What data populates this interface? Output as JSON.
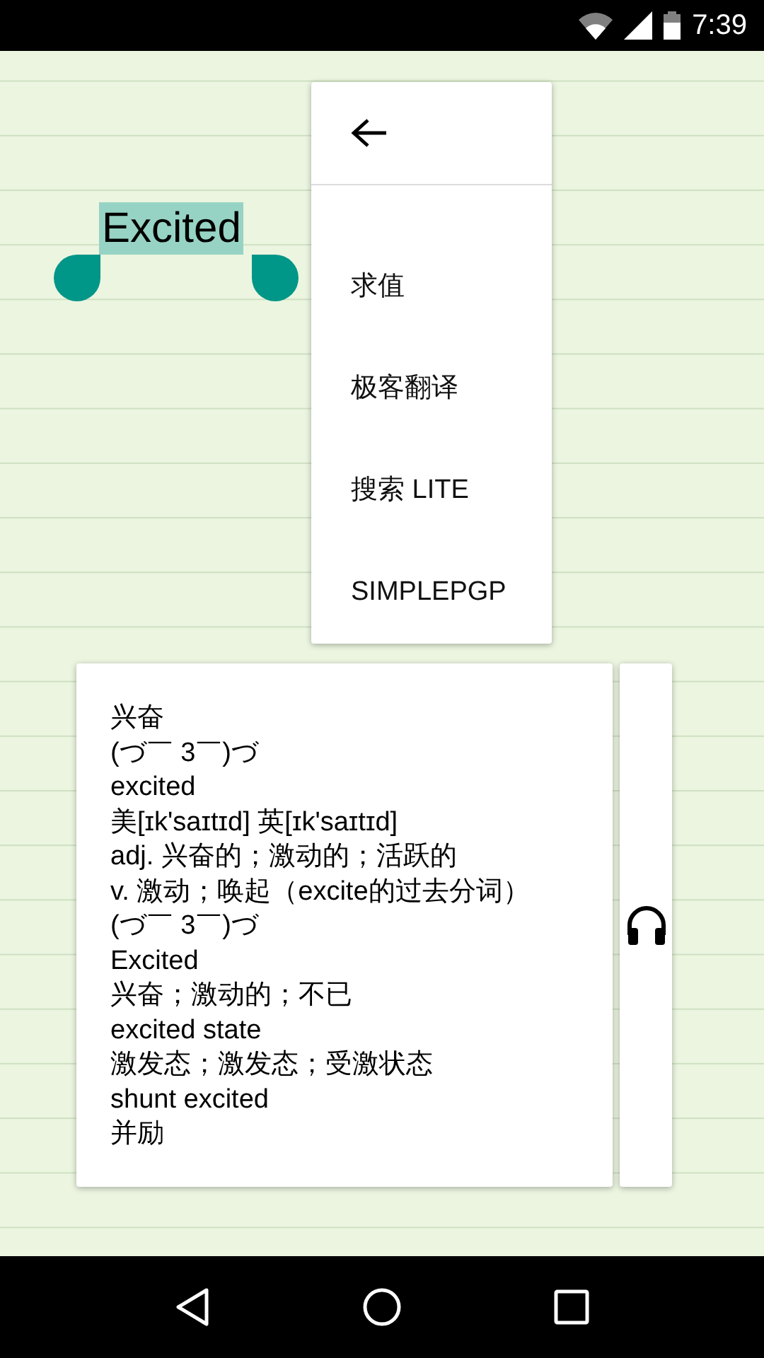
{
  "status_bar": {
    "time": "7:39"
  },
  "selection": {
    "text": "Excited"
  },
  "menu": {
    "items": [
      {
        "label": "求值"
      },
      {
        "label": "极客翻译"
      },
      {
        "label": "搜索 LITE"
      },
      {
        "label": "SIMPLEPGP"
      }
    ]
  },
  "translation": {
    "lines": [
      "兴奋",
      "(づ￣ 3￣)づ",
      "excited",
      "美[ɪk'saɪtɪd] 英[ɪk'saɪtɪd]",
      "adj. 兴奋的；激动的；活跃的",
      "v. 激动；唤起（excite的过去分词）",
      "(づ￣ 3￣)づ",
      "Excited",
      "兴奋；激动的；不已",
      "excited state",
      "激发态；激发态；受激状态",
      "shunt excited",
      "并励"
    ]
  }
}
